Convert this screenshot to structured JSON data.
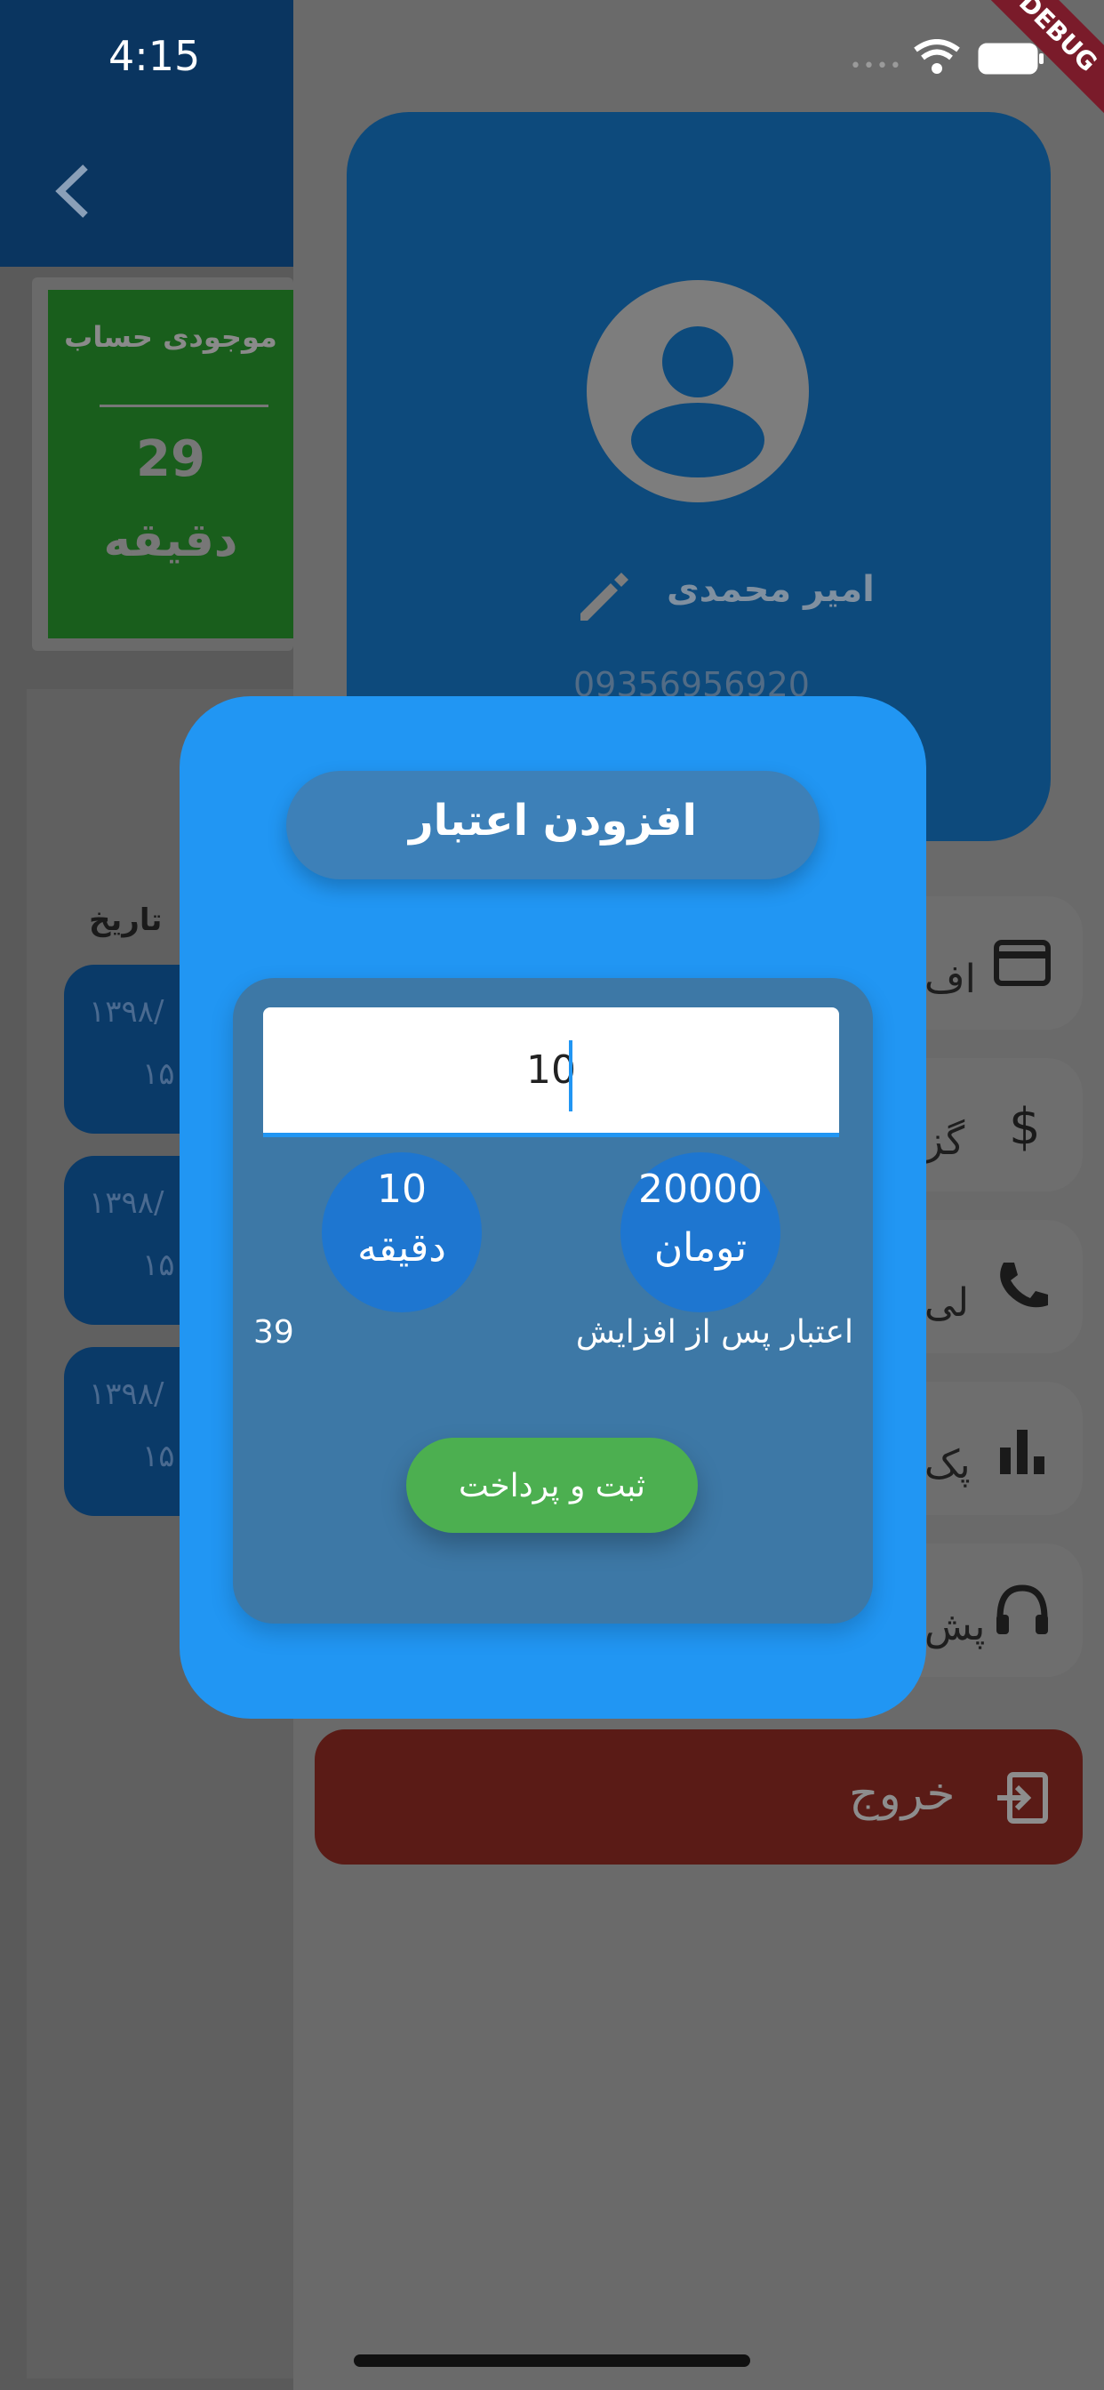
{
  "status_bar": {
    "time": "4:15",
    "signal_dots": "••••",
    "debug": "DEBUG"
  },
  "left_page": {
    "back_icon": "chevron-left-icon",
    "balance": {
      "title": "موجودی حساب",
      "value": "29",
      "unit": "دقیقه"
    },
    "history_header": "تاریخ",
    "history_rows": [
      {
        "date": "۱۳۹۸/",
        "time": "۱۵"
      },
      {
        "date": "۱۳۹۸/",
        "time": "۱۵"
      },
      {
        "date": "۱۳۹۸/",
        "time": "۱۵"
      }
    ]
  },
  "drawer": {
    "profile": {
      "name": "امیر محمدی",
      "phone": "09356956920",
      "avatar_icon": "account-circle-icon",
      "edit_icon": "pencil-icon"
    },
    "menu": [
      {
        "label": "اف",
        "icon": "credit-card-icon"
      },
      {
        "label": "گز",
        "icon": "dollar-icon"
      },
      {
        "label": "لی",
        "icon": "phone-icon"
      },
      {
        "label": "پک",
        "icon": "bar-chart-icon"
      },
      {
        "label": "پش",
        "icon": "headset-icon"
      }
    ],
    "logout": {
      "label": "خروج",
      "icon": "logout-icon"
    }
  },
  "dialog": {
    "title": "افزودن اعتبار",
    "amount_value": "10",
    "minutes": {
      "value": "10",
      "unit": "دقیقه"
    },
    "price": {
      "value": "20000",
      "unit": "تومان"
    },
    "after_label": "اعتبار پس از افزایش",
    "after_value": "39",
    "submit_label": "ثبت و پرداخت"
  },
  "colors": {
    "dialog_bg": "#2196f3",
    "panel_bg": "#3d78a6",
    "submit_bg": "#4caf50",
    "circle_bg": "#1e76d0",
    "logout_bg": "#5a1b16"
  }
}
